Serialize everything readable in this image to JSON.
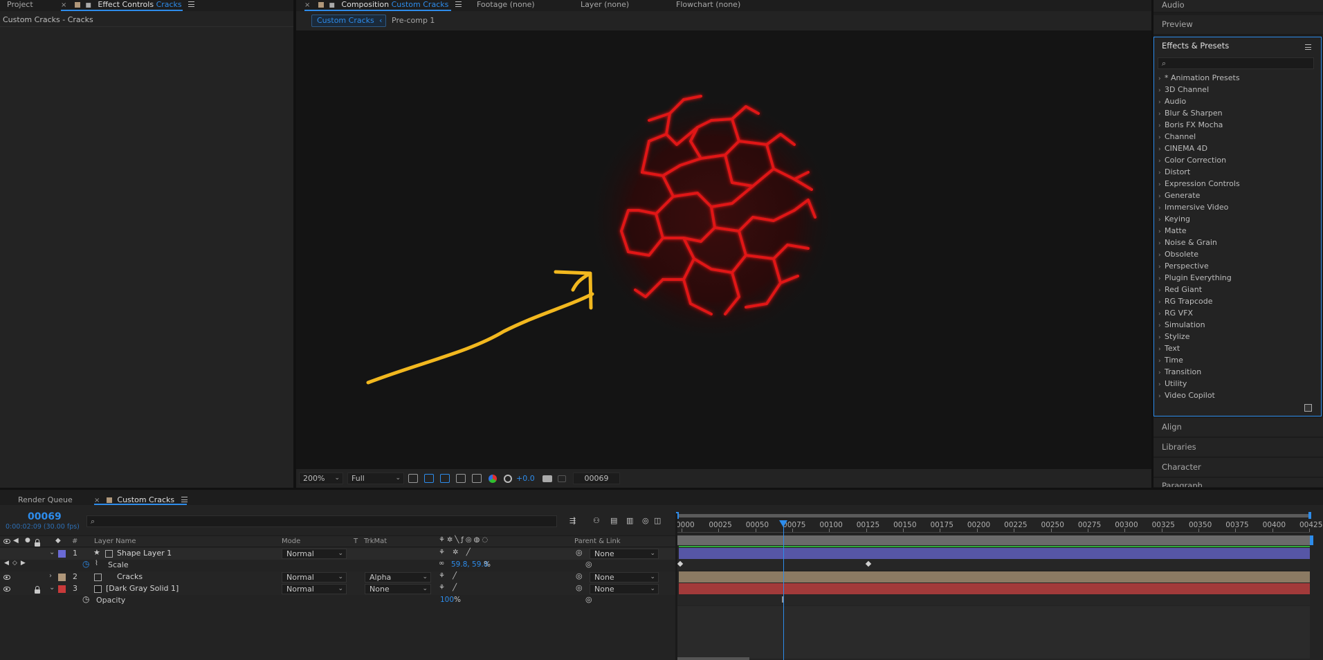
{
  "left_panel": {
    "tab_project": "Project",
    "tab_effect_controls": "Effect Controls",
    "tab_effect_controls_target": "Cracks",
    "subtitle": "Custom Cracks - Cracks"
  },
  "comp_panel": {
    "tab_composition": "Composition",
    "tab_composition_name": "Custom Cracks",
    "tab_footage": "Footage",
    "tab_footage_value": "(none)",
    "tab_layer": "Layer",
    "tab_layer_value": "(none)",
    "tab_flowchart": "Flowchart",
    "tab_flowchart_value": "(none)",
    "breadcrumb_active": "Custom Cracks",
    "breadcrumb_other": "Pre-comp 1"
  },
  "viewer_bar": {
    "zoom": "200%",
    "resolution": "Full",
    "exposure": "+0.0",
    "frame": "00069"
  },
  "right_panel": {
    "audio": "Audio",
    "preview": "Preview",
    "effects_presets": "Effects & Presets",
    "search_placeholder": "",
    "items": [
      "* Animation Presets",
      "3D Channel",
      "Audio",
      "Blur & Sharpen",
      "Boris FX Mocha",
      "Channel",
      "CINEMA 4D",
      "Color Correction",
      "Distort",
      "Expression Controls",
      "Generate",
      "Immersive Video",
      "Keying",
      "Matte",
      "Noise & Grain",
      "Obsolete",
      "Perspective",
      "Plugin Everything",
      "Red Giant",
      "RG Trapcode",
      "RG VFX",
      "Simulation",
      "Stylize",
      "Text",
      "Time",
      "Transition",
      "Utility",
      "Video Copilot"
    ],
    "align": "Align",
    "libraries": "Libraries",
    "character": "Character",
    "paragraph": "Paragraph"
  },
  "timeline": {
    "tab_render_queue": "Render Queue",
    "tab_comp": "Custom Cracks",
    "current_frame": "00069",
    "current_time": "0:00:02:09 (30.00 fps)",
    "columns": {
      "hash": "#",
      "layer_name": "Layer Name",
      "mode": "Mode",
      "t": "T",
      "trkmat": "TrkMat",
      "parent_link": "Parent & Link"
    },
    "layers": [
      {
        "num": "1",
        "name": "Shape Layer 1",
        "mode": "Normal",
        "trkmat": "",
        "parent": "None",
        "color": "#6b6bd6"
      },
      {
        "num": "2",
        "name": "Cracks",
        "mode": "Normal",
        "trkmat": "Alpha",
        "parent": "None",
        "color": "#b0977a"
      },
      {
        "num": "3",
        "name": "[Dark Gray Solid 1]",
        "mode": "Normal",
        "trkmat": "None",
        "parent": "None",
        "color": "#c93a3a"
      }
    ],
    "scale_prop": {
      "label": "Scale",
      "value": "59.8, 59.8",
      "unit": "%"
    },
    "opacity_prop": {
      "label": "Opacity",
      "value": "100",
      "unit": "%"
    },
    "ruler_ticks": [
      "0000",
      "00025",
      "00050",
      "00075",
      "00100",
      "00125",
      "00150",
      "00175",
      "00200",
      "00225",
      "00250",
      "00275",
      "00300",
      "00325",
      "00350",
      "00375",
      "00400",
      "00425"
    ],
    "playhead_frame": 69,
    "total_frames": 425
  },
  "colors": {
    "accent": "#2d8ceb",
    "annotation_arrow": "#f2b81f",
    "cracks": "#e01414"
  }
}
